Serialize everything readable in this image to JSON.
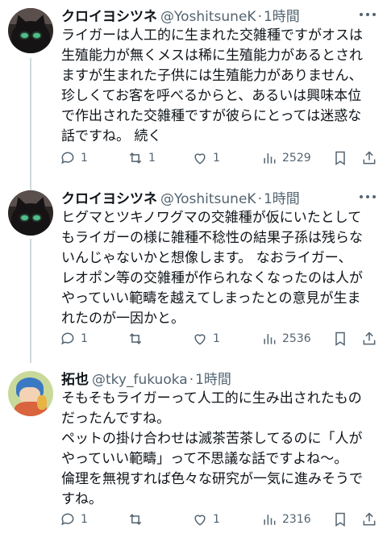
{
  "tweets": [
    {
      "name": "クロイヨシツネ",
      "handle": "@YoshitsuneK",
      "separator": "·",
      "time": "1時間",
      "avatar_icon": "black-cat-avatar",
      "text": "ライガーは人工的に生まれた交雑種ですがオスは\n生殖能力が無くメスは稀に生殖能力があるとされ\nますが生まれた子供には生殖能力がありません、\n珍しくてお客を呼べるからと、あるいは興味本位\nで作出された交雑種ですが彼らにとっては迷惑な\n話ですね。 続く",
      "replies": "1",
      "retweets": "1",
      "likes": "1",
      "views": "2529"
    },
    {
      "name": "クロイヨシツネ",
      "handle": "@YoshitsuneK",
      "separator": "·",
      "time": "1時間",
      "avatar_icon": "black-cat-avatar",
      "text": "ヒグマとツキノワグマの交雑種が仮にいたとして\nもライガーの様に雑種不稔性の結果子孫は残らな\nいんじゃないかと想像します。 なおライガー、\nレオポン等の交雑種が作られなくなったのは人が\nやっていい範疇を越えてしまったとの意見が生ま\nれたのが一因かと。",
      "replies": "1",
      "retweets": "",
      "likes": "1",
      "views": "2536"
    },
    {
      "name": "拓也",
      "handle": "@tky_fukuoka",
      "separator": "·",
      "time": "1時間",
      "avatar_icon": "anime-character-avatar",
      "text": "そもそもライガーって人工的に生み出されたもの\nだったんですね。\nペットの掛け合わせは滅茶苦茶してるのに「人が\nやっていい範疇」って不思議な話ですよね〜。\n倫理を無視すれば色々な研究が一気に進みそうで\nすね。",
      "replies": "1",
      "retweets": "",
      "likes": "1",
      "views": "2316"
    }
  ],
  "icons": {
    "reply": "reply-icon",
    "retweet": "retweet-icon",
    "like": "heart-icon",
    "views": "views-icon",
    "bookmark": "bookmark-icon",
    "share": "share-icon",
    "more": "more-icon"
  },
  "colors": {
    "text": "#0f1419",
    "secondary": "#536471",
    "thread_line": "#cfd9de",
    "background": "#ffffff"
  }
}
